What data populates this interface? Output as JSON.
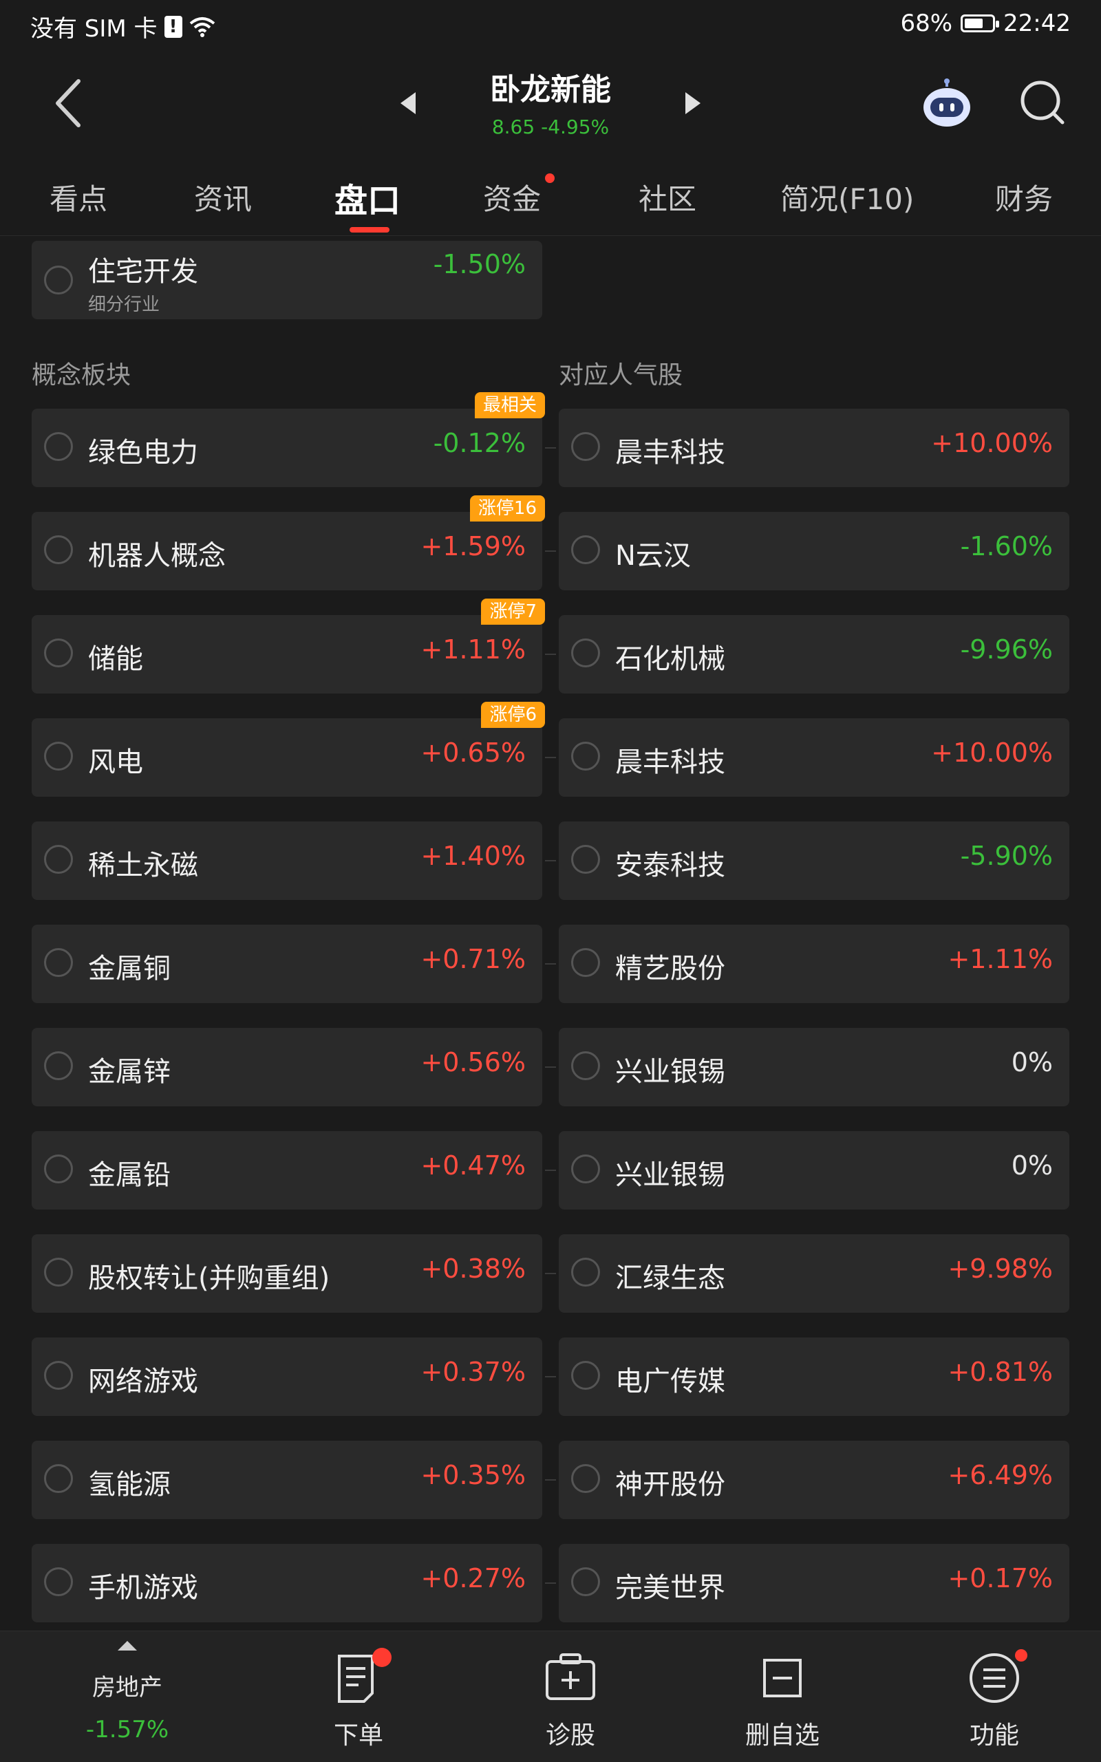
{
  "status_bar": {
    "carrier": "没有 SIM 卡",
    "battery": "68%",
    "time": "22:42"
  },
  "header": {
    "title": "卧龙新能",
    "price": "8.65",
    "change": "-4.95%"
  },
  "tabs": [
    "看点",
    "资讯",
    "盘口",
    "资金",
    "社区",
    "简况(F10)",
    "财务"
  ],
  "top_item": {
    "name": "住宅开发",
    "type": "细分行业",
    "pct": "-1.50%"
  },
  "sections": {
    "concepts": "概念板块",
    "popular": "对应人气股"
  },
  "rows": [
    {
      "concept": "绿色电力",
      "concept_pct": "-0.12%",
      "badge": "最相关",
      "stock": "晨丰科技",
      "stock_pct": "+10.00%"
    },
    {
      "concept": "机器人概念",
      "concept_pct": "+1.59%",
      "badge": "涨停16",
      "stock": "N云汉",
      "stock_pct": "-1.60%"
    },
    {
      "concept": "储能",
      "concept_pct": "+1.11%",
      "badge": "涨停7",
      "stock": "石化机械",
      "stock_pct": "-9.96%"
    },
    {
      "concept": "风电",
      "concept_pct": "+0.65%",
      "badge": "涨停6",
      "stock": "晨丰科技",
      "stock_pct": "+10.00%"
    },
    {
      "concept": "稀土永磁",
      "concept_pct": "+1.40%",
      "badge": "",
      "stock": "安泰科技",
      "stock_pct": "-5.90%"
    },
    {
      "concept": "金属铜",
      "concept_pct": "+0.71%",
      "badge": "",
      "stock": "精艺股份",
      "stock_pct": "+1.11%"
    },
    {
      "concept": "金属锌",
      "concept_pct": "+0.56%",
      "badge": "",
      "stock": "兴业银锡",
      "stock_pct": "0%"
    },
    {
      "concept": "金属铅",
      "concept_pct": "+0.47%",
      "badge": "",
      "stock": "兴业银锡",
      "stock_pct": "0%"
    },
    {
      "concept": "股权转让(并购重组)",
      "concept_pct": "+0.38%",
      "badge": "",
      "stock": "汇绿生态",
      "stock_pct": "+9.98%"
    },
    {
      "concept": "网络游戏",
      "concept_pct": "+0.37%",
      "badge": "",
      "stock": "电广传媒",
      "stock_pct": "+0.81%"
    },
    {
      "concept": "氢能源",
      "concept_pct": "+0.35%",
      "badge": "",
      "stock": "神开股份",
      "stock_pct": "+6.49%"
    },
    {
      "concept": "手机游戏",
      "concept_pct": "+0.27%",
      "badge": "",
      "stock": "完美世界",
      "stock_pct": "+0.17%"
    }
  ],
  "bottom_bar": {
    "sector_name": "房地产",
    "sector_pct": "-1.57%",
    "items": [
      "下单",
      "诊股",
      "删自选",
      "功能"
    ]
  },
  "colors": {
    "up": "#ff4d40",
    "down": "#3bbf3b",
    "accent": "#ff3b30",
    "badge": "#ffa010"
  }
}
